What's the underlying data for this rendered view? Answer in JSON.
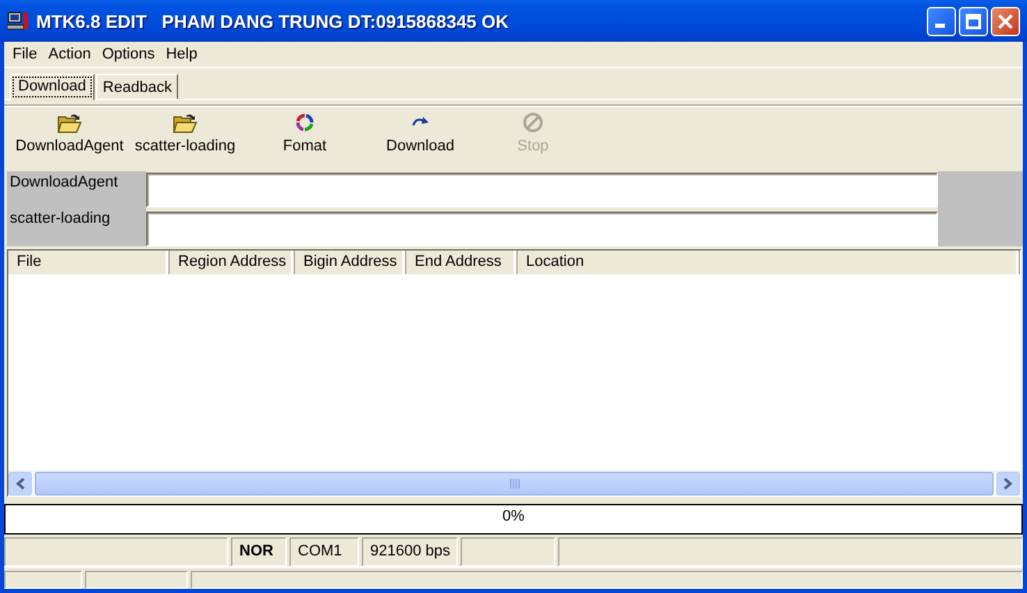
{
  "window": {
    "title": "MTK6.8 EDIT   PHAM DANG TRUNG DT:0915868345 OK"
  },
  "menu": [
    "File",
    "Action",
    "Options",
    "Help"
  ],
  "tabs": [
    {
      "label": "Download",
      "selected": true
    },
    {
      "label": "Readback",
      "selected": false
    }
  ],
  "toolbar": [
    {
      "label": "DownloadAgent",
      "kind": "folder",
      "disabled": false
    },
    {
      "label": "scatter-loading",
      "kind": "folder",
      "disabled": false
    },
    {
      "label": "Fomat",
      "kind": "format",
      "disabled": false
    },
    {
      "label": "Download",
      "kind": "download",
      "disabled": false
    },
    {
      "label": "Stop",
      "kind": "stop",
      "disabled": true
    }
  ],
  "fields": [
    {
      "label": "DownloadAgent"
    },
    {
      "label": "scatter-loading"
    }
  ],
  "table": {
    "columns": [
      "File",
      "Region Address",
      "Bigin Address",
      "End Address",
      "Location"
    ]
  },
  "progress": {
    "level": 0,
    "reading": "0%"
  },
  "status_bar": {
    "mode": "NOR",
    "port": "COM1",
    "baud": "921600 bps"
  }
}
